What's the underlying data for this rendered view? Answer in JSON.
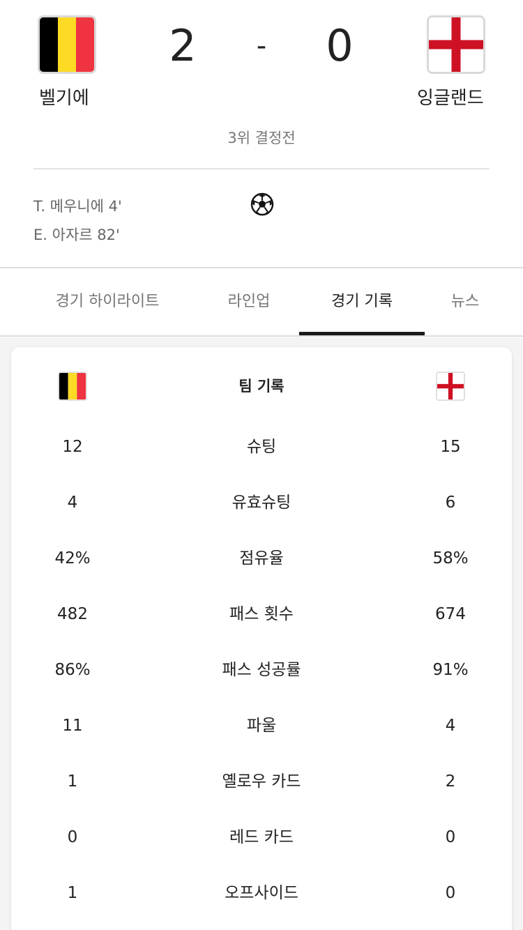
{
  "match": {
    "home": {
      "name": "벨기에",
      "score": "2"
    },
    "away": {
      "name": "잉글랜드",
      "score": "0"
    },
    "separator": "-",
    "stage": "3위 결정전"
  },
  "scorers": [
    "T. 메우니에 4'",
    "E. 아자르 82'"
  ],
  "tabs": [
    {
      "label": "경기 하이라이트",
      "active": false
    },
    {
      "label": "라인업",
      "active": false
    },
    {
      "label": "경기 기록",
      "active": true
    },
    {
      "label": "뉴스",
      "active": false
    }
  ],
  "team_stats": {
    "title": "팀 기록",
    "rows": [
      {
        "label": "슈팅",
        "home": "12",
        "away": "15"
      },
      {
        "label": "유효슈팅",
        "home": "4",
        "away": "6"
      },
      {
        "label": "점유율",
        "home": "42%",
        "away": "58%"
      },
      {
        "label": "패스 횟수",
        "home": "482",
        "away": "674"
      },
      {
        "label": "패스 성공률",
        "home": "86%",
        "away": "91%"
      },
      {
        "label": "파울",
        "home": "11",
        "away": "4"
      },
      {
        "label": "옐로우 카드",
        "home": "1",
        "away": "2"
      },
      {
        "label": "레드 카드",
        "home": "0",
        "away": "0"
      },
      {
        "label": "오프사이드",
        "home": "1",
        "away": "0"
      }
    ]
  },
  "colors": {
    "belgium": [
      "#000000",
      "#FDDA24",
      "#EF3340"
    ],
    "england": [
      "#FFFFFF",
      "#CE1124"
    ]
  },
  "icons": {
    "goal": "soccer-ball-icon"
  }
}
